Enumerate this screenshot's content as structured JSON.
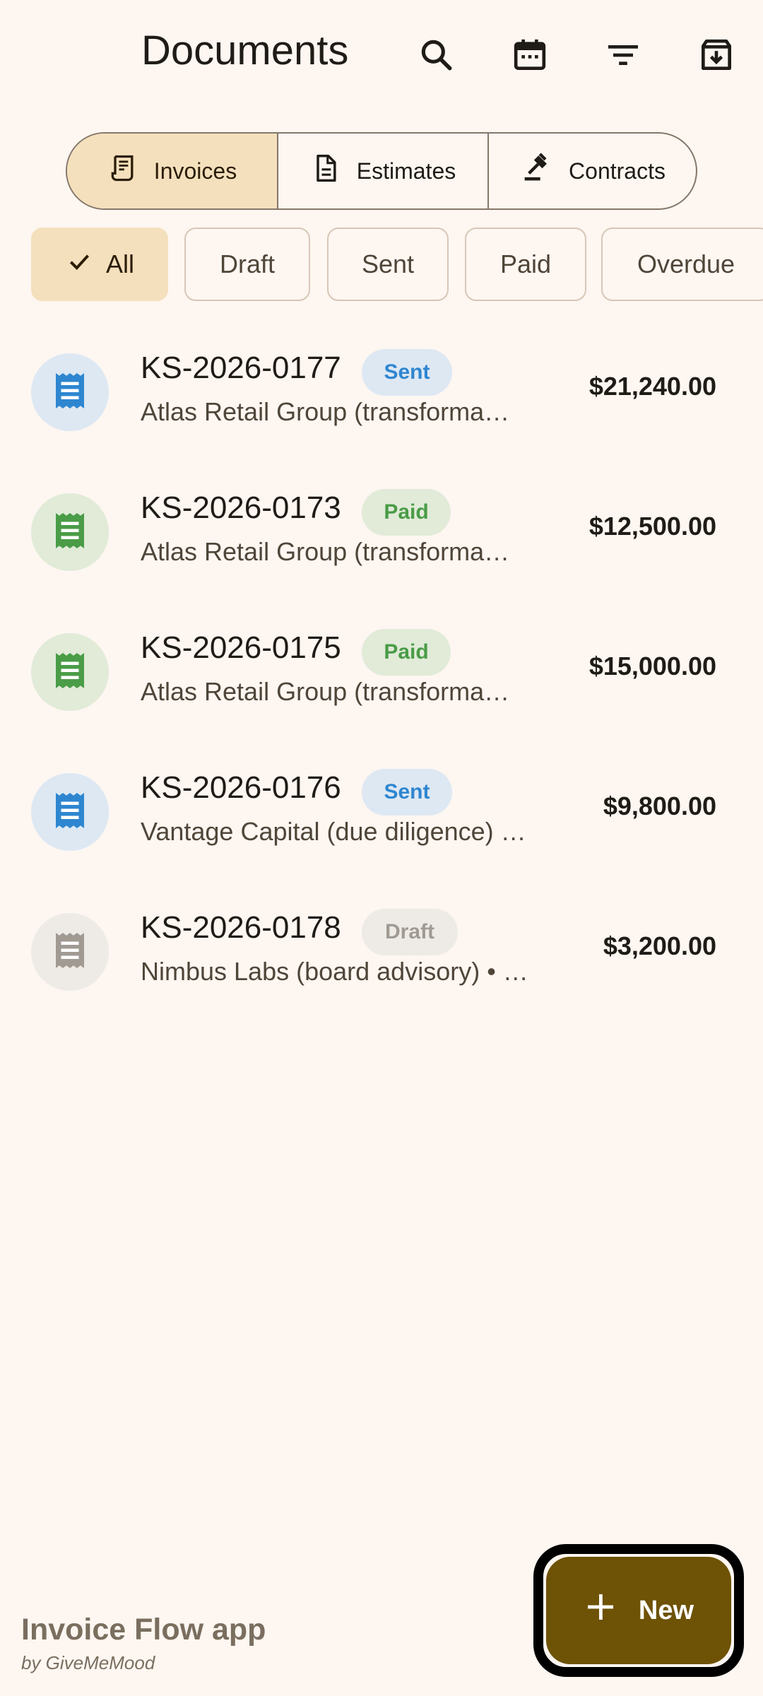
{
  "header": {
    "title": "Documents",
    "icons": [
      "search-icon",
      "calendar-icon",
      "filter-icon",
      "archive-icon"
    ]
  },
  "tabs": [
    {
      "label": "Invoices",
      "icon": "receipt-icon",
      "active": true
    },
    {
      "label": "Estimates",
      "icon": "document-icon",
      "active": false
    },
    {
      "label": "Contracts",
      "icon": "gavel-icon",
      "active": false
    }
  ],
  "filters": [
    {
      "label": "All",
      "selected": true
    },
    {
      "label": "Draft",
      "selected": false
    },
    {
      "label": "Sent",
      "selected": false
    },
    {
      "label": "Paid",
      "selected": false
    },
    {
      "label": "Overdue",
      "selected": false
    }
  ],
  "invoices": [
    {
      "number": "KS-2026-0177",
      "status": "Sent",
      "client": "Atlas Retail Group (transforma…",
      "amount": "$21,240.00"
    },
    {
      "number": "KS-2026-0173",
      "status": "Paid",
      "client": "Atlas Retail Group (transforma…",
      "amount": "$12,500.00"
    },
    {
      "number": "KS-2026-0175",
      "status": "Paid",
      "client": "Atlas Retail Group (transforma…",
      "amount": "$15,000.00"
    },
    {
      "number": "KS-2026-0176",
      "status": "Sent",
      "client": "Vantage Capital (due diligence) …",
      "amount": "$9,800.00"
    },
    {
      "number": "KS-2026-0178",
      "status": "Draft",
      "client": "Nimbus Labs (board advisory) • …",
      "amount": "$3,200.00"
    }
  ],
  "status_colors": {
    "Sent": {
      "bg": "#dde8f3",
      "fg": "#2e86d0",
      "avatar_bg": "#dde8f3",
      "icon": "#2e86d0"
    },
    "Paid": {
      "bg": "#e1ebd8",
      "fg": "#4a9c47",
      "avatar_bg": "#e1ebd8",
      "icon": "#4a9c47"
    },
    "Draft": {
      "bg": "#eeebe7",
      "fg": "#a09a93",
      "avatar_bg": "#eeebe7",
      "icon": "#a09a93"
    }
  },
  "brand": {
    "name": "Invoice Flow app",
    "by": "by GiveMeMood"
  },
  "fab": {
    "label": "New",
    "icon": "plus-icon"
  }
}
